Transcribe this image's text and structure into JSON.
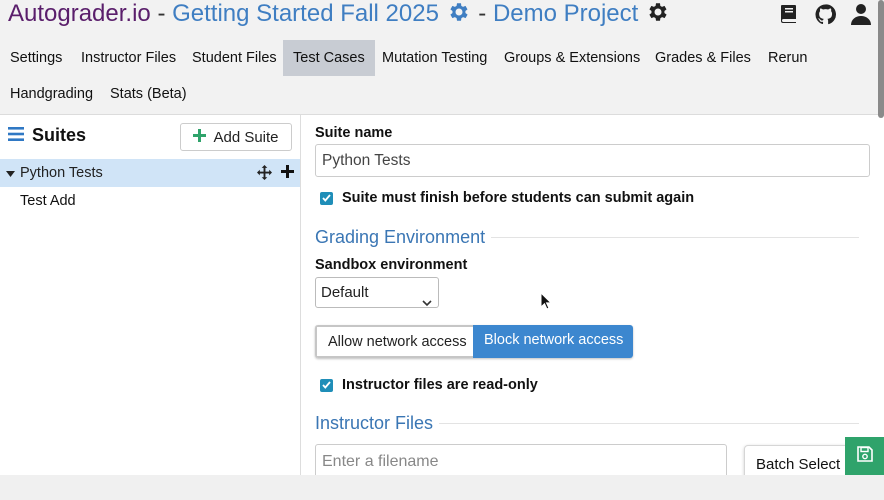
{
  "header": {
    "brand": "Autograder.io",
    "separator_1": " - ",
    "course": "Getting Started Fall 2025",
    "separator_2": " - ",
    "project": "Demo Project",
    "icons": [
      "gear-icon",
      "book-icon",
      "github-icon",
      "user-icon"
    ]
  },
  "tabs": [
    {
      "label": "Settings"
    },
    {
      "label": "Instructor Files"
    },
    {
      "label": "Student Files"
    },
    {
      "label": "Test Cases",
      "active": true
    },
    {
      "label": "Mutation Testing"
    },
    {
      "label": "Groups & Extensions"
    },
    {
      "label": "Grades & Files"
    },
    {
      "label": "Rerun"
    },
    {
      "label": "Handgrading"
    },
    {
      "label": "Stats (Beta)"
    }
  ],
  "sidebar": {
    "title": "Suites",
    "add_suite_label": "Add Suite",
    "suites": [
      {
        "name": "Python Tests",
        "expanded": true,
        "tests": [
          {
            "name": "Test Add"
          }
        ]
      }
    ]
  },
  "main": {
    "suite_name_label": "Suite name",
    "suite_name_value": "Python Tests",
    "finish_before_submit_label": "Suite must finish before students can submit again",
    "finish_before_submit_checked": true,
    "grading_env_heading": "Grading Environment",
    "sandbox_label": "Sandbox environment",
    "sandbox_value": "Default",
    "allow_network_label": "Allow network access",
    "block_network_label": "Block network access",
    "network_selected": "block",
    "instructor_readonly_label": "Instructor files are read-only",
    "instructor_readonly_checked": true,
    "instructor_files_heading": "Instructor Files",
    "filename_placeholder": "Enter a filename",
    "batch_select_label": "Batch Select"
  },
  "colors": {
    "brand": "#5a1e6b",
    "link": "#3f7ec2",
    "active_tab": "#c8ccd3",
    "selected_row": "#d0e4f7",
    "primary": "#3c87cf",
    "checkbox": "#1f8eb8",
    "save": "#2fa36b"
  }
}
